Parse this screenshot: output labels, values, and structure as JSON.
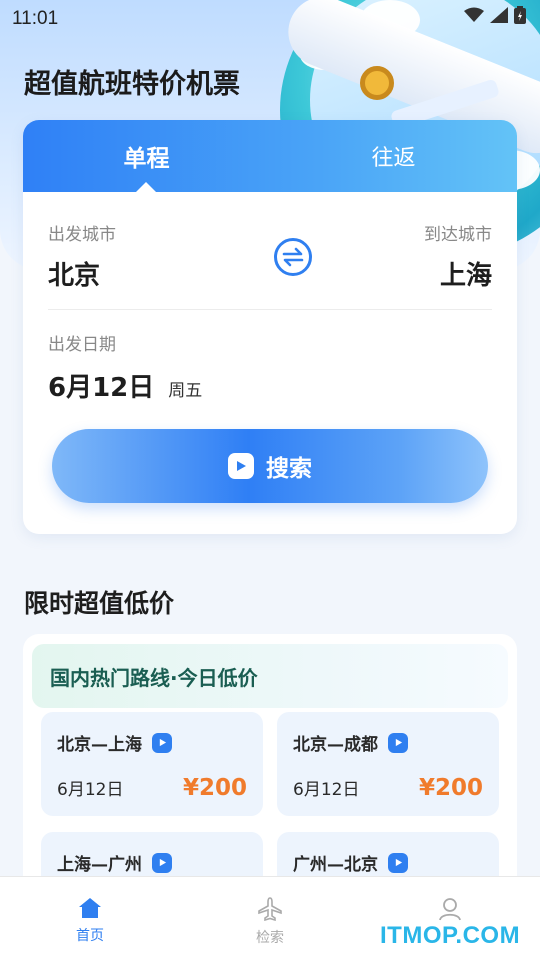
{
  "status_bar": {
    "time": "11:01"
  },
  "page_title": "超值航班特价机票",
  "search": {
    "tabs": [
      {
        "label": "单程",
        "active": true
      },
      {
        "label": "往返",
        "active": false
      }
    ],
    "from_label": "出发城市",
    "from_city": "北京",
    "to_label": "到达城市",
    "to_city": "上海",
    "date_label": "出发日期",
    "date_value": "6月12日",
    "date_weekday": "周五",
    "button_label": "搜索"
  },
  "deals": {
    "section_title": "限时超值低价",
    "header": "国内热门路线·今日低价",
    "routes": [
      {
        "name": "北京—上海",
        "date": "6月12日",
        "price": "¥200"
      },
      {
        "name": "北京—成都",
        "date": "6月12日",
        "price": "¥200"
      },
      {
        "name": "上海—广州"
      },
      {
        "name": "广州—北京"
      }
    ]
  },
  "nav": {
    "items": [
      {
        "label": "首页",
        "icon": "home-icon",
        "active": true
      },
      {
        "label": "检索",
        "icon": "plane-icon",
        "active": false
      },
      {
        "label": "",
        "icon": "user-icon",
        "active": false
      }
    ]
  },
  "watermark": "ITMOP.COM",
  "colors": {
    "primary": "#2f7ff0",
    "price": "#f07b2c",
    "deal_header_text": "#1a5e52"
  }
}
